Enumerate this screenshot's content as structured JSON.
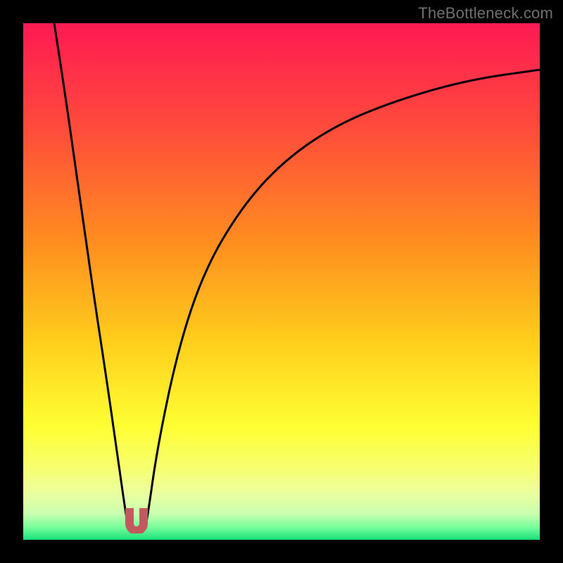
{
  "watermark": {
    "text": "TheBottleneck.com"
  },
  "chart_data": {
    "type": "line",
    "title": "",
    "xlabel": "",
    "ylabel": "",
    "xlim": [
      0,
      100
    ],
    "ylim": [
      0,
      100
    ],
    "grid": false,
    "legend": false,
    "series": [
      {
        "name": "left-branch",
        "x": [
          6,
          8,
          10,
          12,
          14,
          16,
          18,
          20,
          20.5
        ],
        "values": [
          100,
          87,
          73,
          59,
          45,
          32,
          18,
          4,
          2
        ]
      },
      {
        "name": "right-branch",
        "x": [
          23.5,
          24,
          26,
          30,
          35,
          42,
          50,
          60,
          72,
          86,
          100
        ],
        "values": [
          2,
          4,
          18,
          37,
          52,
          64,
          73,
          80,
          85,
          89,
          91
        ]
      }
    ],
    "marker": {
      "name": "bottleneck-point",
      "x": 22,
      "y": 2,
      "color": "#c1595f"
    },
    "background_gradient": {
      "stops": [
        {
          "pos": 0.0,
          "color": "#ff1a53"
        },
        {
          "pos": 0.2,
          "color": "#ff4a3c"
        },
        {
          "pos": 0.42,
          "color": "#ff8c1f"
        },
        {
          "pos": 0.62,
          "color": "#ffcf1c"
        },
        {
          "pos": 0.78,
          "color": "#ffff33"
        },
        {
          "pos": 0.86,
          "color": "#f7ff6e"
        },
        {
          "pos": 0.91,
          "color": "#ecffa0"
        },
        {
          "pos": 0.95,
          "color": "#c9ffb0"
        },
        {
          "pos": 0.975,
          "color": "#79ff9c"
        },
        {
          "pos": 1.0,
          "color": "#18e07a"
        }
      ]
    }
  }
}
